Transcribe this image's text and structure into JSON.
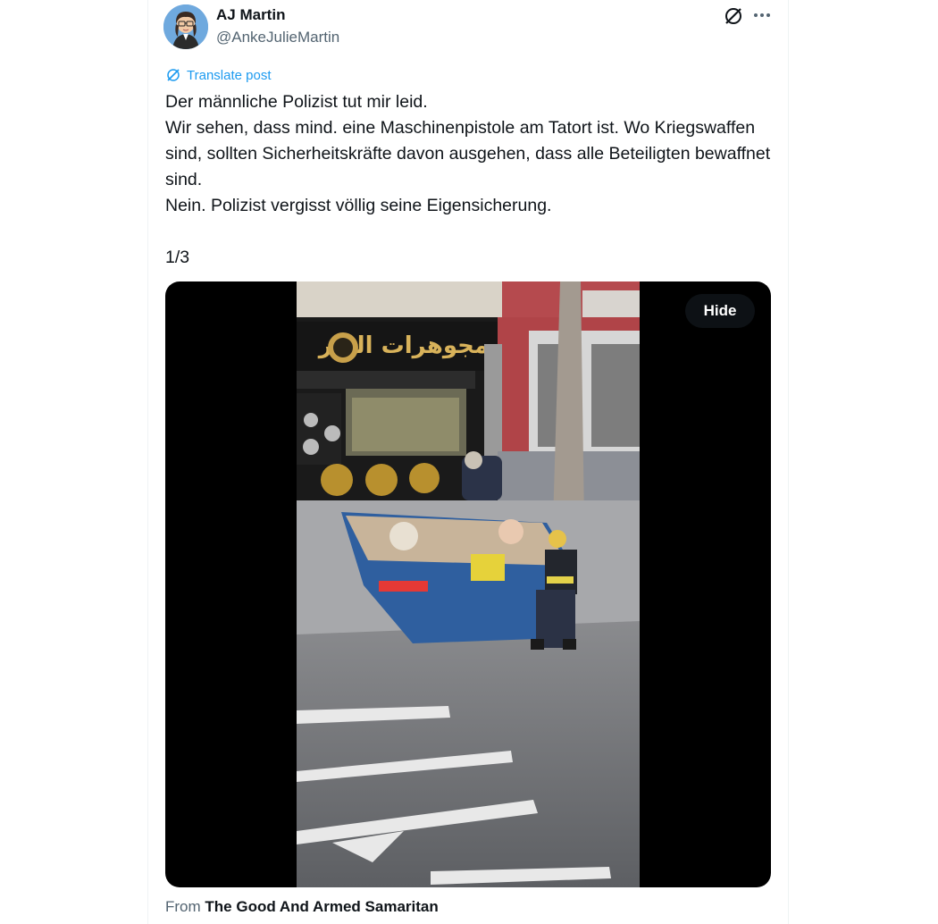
{
  "author": {
    "name": "AJ Martin",
    "handle": "@AnkeJulieMartin"
  },
  "icons": {
    "avatar": "avatar-image",
    "grok": "grok-icon",
    "more": "more-dots-icon",
    "translate": "translate-icon"
  },
  "translate_label": "Translate post",
  "post_text": "Der männliche Polizist tut mir leid.\nWir sehen, dass mind. eine Maschinenpistole am Tatort ist. Wo Kriegswaffen sind, sollten Sicherheitskräfte davon ausgehen, dass alle Beteiligten bewaffnet sind.\nNein. Polizist vergisst völlig seine Eigensicherung.\n\n1/3",
  "media": {
    "hide_label": "Hide",
    "shop_sign": "مجوهرات الزير"
  },
  "source": {
    "prefix": "From",
    "name": "The Good And Armed Samaritan"
  },
  "colors": {
    "accent": "#1d9bf0",
    "secondary_text": "#536471",
    "primary_text": "#0f1419"
  }
}
